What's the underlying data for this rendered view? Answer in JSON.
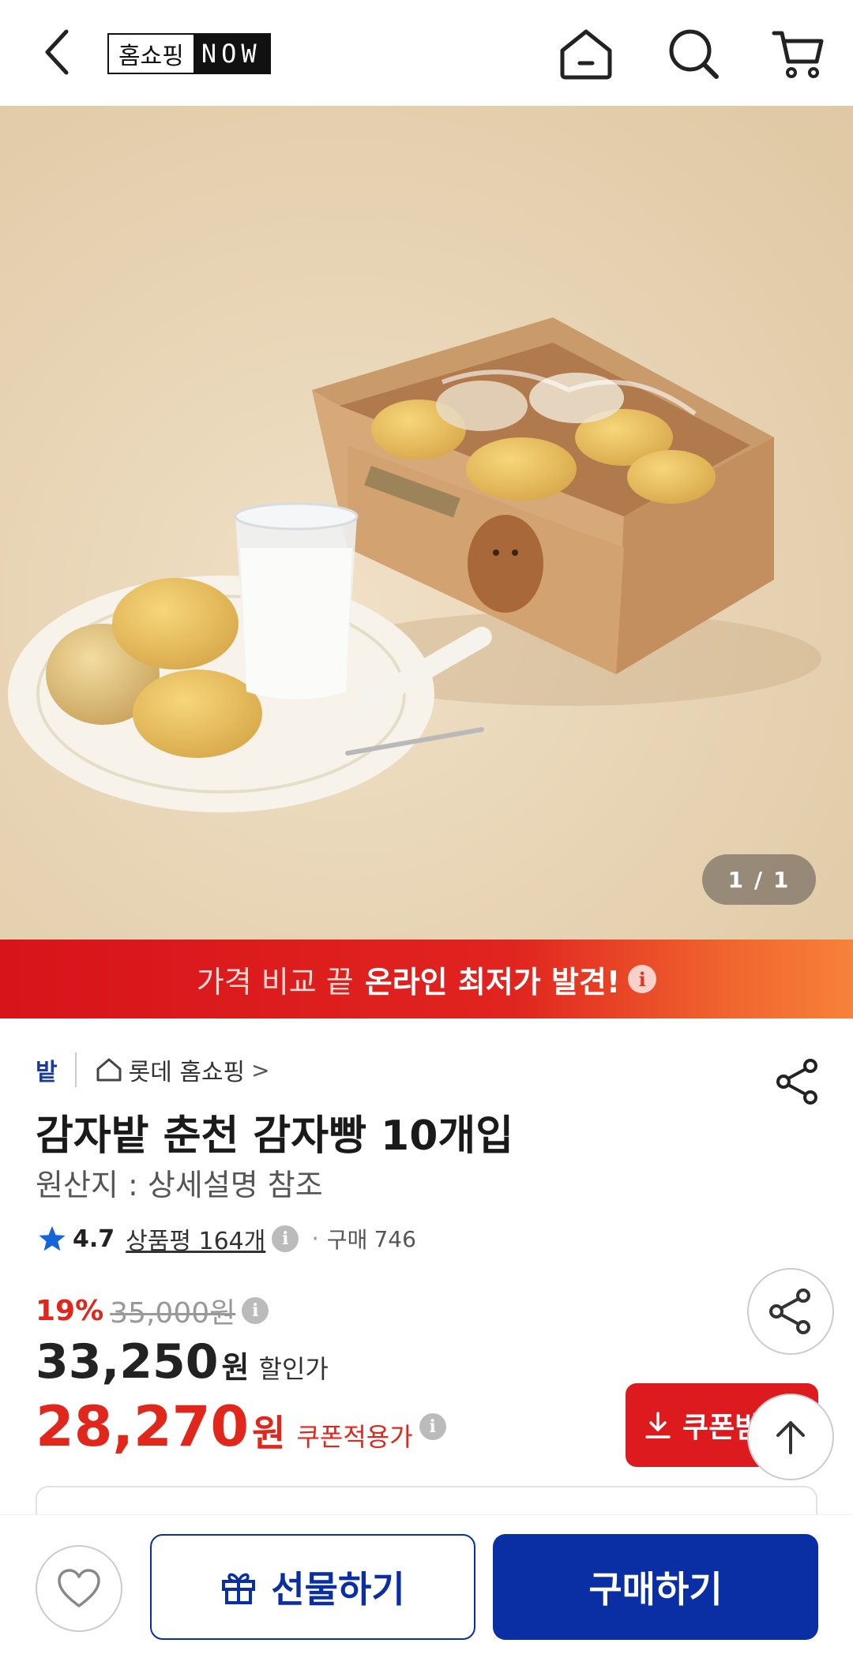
{
  "header": {
    "logo_left": "홈쇼핑",
    "logo_right": "NOW",
    "icons": [
      "back-icon",
      "home-icon",
      "search-icon",
      "cart-icon"
    ]
  },
  "product_image": {
    "counter": "1 / 1"
  },
  "banner": {
    "light_text": "가격 비교 끝",
    "strong_text": "온라인 최저가 발견!",
    "info_symbol": "i"
  },
  "product": {
    "brand_logo": "밭",
    "store": "롯데 홈쇼핑",
    "store_chevron": ">",
    "title": "감자밭 춘천 감자빵 10개입",
    "origin": "원산지 : 상세설명 참조",
    "rating": "4.7",
    "review_link": "상품평 164개",
    "purchase_label": "구매",
    "purchase_count": "746"
  },
  "price": {
    "discount_rate": "19%",
    "original_price": "35,000원",
    "sale_price": "33,250",
    "sale_unit": "원",
    "sale_label": "할인가",
    "coupon_price": "28,270",
    "coupon_unit": "원",
    "coupon_label": "쿠폰적용가",
    "coupon_button": "쿠폰받기"
  },
  "bottom_bar": {
    "gift_label": "선물하기",
    "buy_label": "구매하기"
  },
  "colors": {
    "brand_blue": "#0a2ea3",
    "sale_red": "#e1261c",
    "banner_red": "#d7141a",
    "banner_orange": "#f7823a",
    "star_blue": "#1565d8"
  }
}
